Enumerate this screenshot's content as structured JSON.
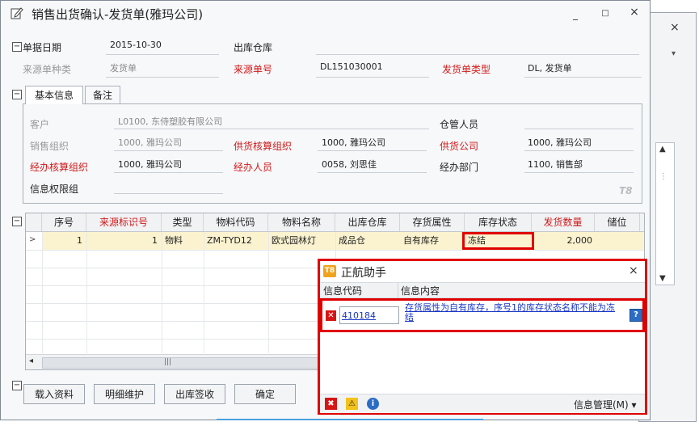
{
  "window": {
    "title": "销售出货确认-发货单(雅玛公司)",
    "min": "_",
    "max": "□",
    "close": "×"
  },
  "bg_window": {
    "close": "×",
    "arrow": "▾",
    "scroll_up": "▲",
    "scroll_mid": "⋮",
    "scroll_down": "▼"
  },
  "header": {
    "doc_date_label": "单据日期",
    "doc_date_value": "2015-10-30",
    "warehouse_label": "出库仓库",
    "source_type_label": "来源单种类",
    "source_type_value": "发货单",
    "source_no_label": "来源单号",
    "source_no_value": "DL151030001",
    "ship_type_label": "发货单类型",
    "ship_type_value": "DL, 发货单"
  },
  "tabs": {
    "basic": "基本信息",
    "note": "备注"
  },
  "basic": {
    "customer_label": "客户",
    "customer_value": "L0100, 东侍塑胶有限公司",
    "keeper_label": "仓管人员",
    "sales_org_label": "销售组织",
    "sales_org_value": "1000, 雅玛公司",
    "supply_acct_org_label": "供货核算组织",
    "supply_acct_org_value": "1000, 雅玛公司",
    "supply_co_label": "供货公司",
    "supply_co_value": "1000, 雅玛公司",
    "handle_acct_org_label": "经办核算组织",
    "handle_acct_org_value": "1000, 雅玛公司",
    "handler_label": "经办人员",
    "handler_value": "0058, 刘思佳",
    "handle_dept_label": "经办部门",
    "handle_dept_value": "1100, 销售部",
    "info_perm_label": "信息权限组",
    "watermark": "T8"
  },
  "grid": {
    "columns": [
      "序号",
      "来源标识号",
      "类型",
      "物料代码",
      "物料名称",
      "出库仓库",
      "存货属性",
      "库存状态",
      "发货数量",
      "储位"
    ],
    "rows": [
      {
        "seq": "1",
        "src_id": "1",
        "type": "物料",
        "code": "ZM-TYD12",
        "name": "欧式园林灯",
        "wh": "成品仓",
        "attr": "自有库存",
        "status": "冻结",
        "qty": "2,000",
        "loc": ""
      }
    ],
    "row_pointer": ">",
    "scroll_left": "◂",
    "scroll_grip": "|||"
  },
  "buttons": {
    "load": "载入资料",
    "detail": "明细维护",
    "sign": "出库签收",
    "ok": "确定"
  },
  "assistant": {
    "icon_text": "T8",
    "title": "正航助手",
    "close": "×",
    "col_code": "信息代码",
    "col_content": "信息内容",
    "error_code": "410184",
    "error_message": "存货属性为自有库存，序号1的库存状态名称不能为冻结",
    "help": "?",
    "footer_error": "✖",
    "footer_warn": "⚠",
    "footer_info": "i",
    "manage": "信息管理(M) ▾"
  }
}
